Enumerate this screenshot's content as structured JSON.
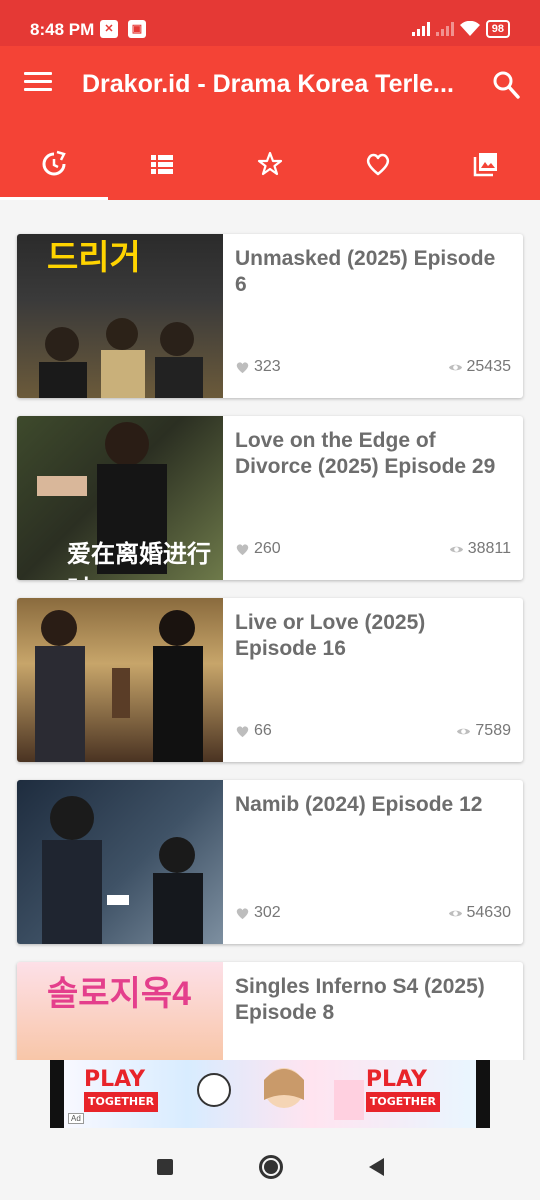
{
  "status": {
    "time": "8:48 PM",
    "battery": "98"
  },
  "app_bar": {
    "title": "Drakor.id - Drama Korea Terle..."
  },
  "tabs": [
    {
      "icon": "history-icon",
      "active": true
    },
    {
      "icon": "list-icon",
      "active": false
    },
    {
      "icon": "star-icon",
      "active": false
    },
    {
      "icon": "heart-icon",
      "active": false
    },
    {
      "icon": "gallery-icon",
      "active": false
    }
  ],
  "items": [
    {
      "title": "Unmasked (2025) Episode 6",
      "likes": "323",
      "views": "25435",
      "thumb_text": "드리거"
    },
    {
      "title": "Love on the Edge of Divorce (2025) Episode 29",
      "likes": "260",
      "views": "38811",
      "thumb_text": "爱在离婚进行时"
    },
    {
      "title": "Live or Love (2025) Episode 16",
      "likes": "66",
      "views": "7589",
      "thumb_text": ""
    },
    {
      "title": "Namib (2024) Episode 12",
      "likes": "302",
      "views": "54630",
      "thumb_text": ""
    },
    {
      "title": "Singles Inferno S4 (2025) Episode 8",
      "likes": "",
      "views": "",
      "thumb_text": "솔로지옥4"
    }
  ],
  "ad": {
    "logo_left": "PLAY",
    "logo_left_sub": "TOGETHER",
    "logo_right": "PLAY",
    "logo_right_sub": "TOGETHER",
    "mark": "Ad"
  },
  "colors": {
    "app_bar": "#f44336",
    "status_bar": "#e53935",
    "card_title": "#6d6d6d"
  }
}
